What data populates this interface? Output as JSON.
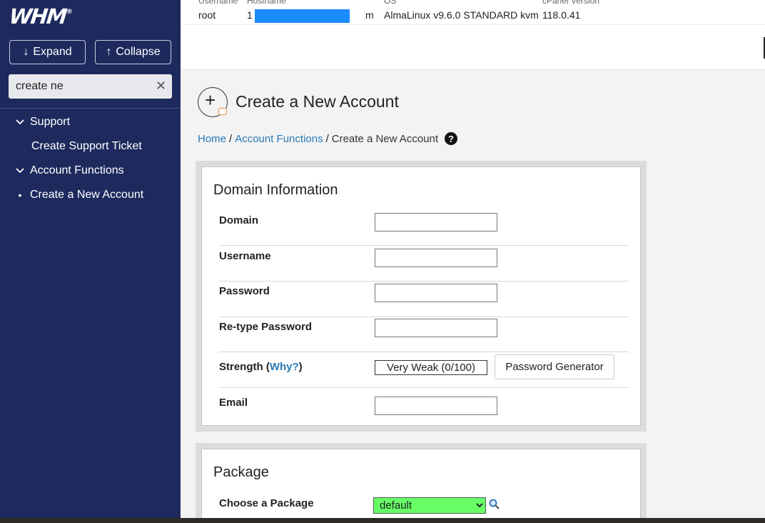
{
  "sidebar": {
    "logo": "WHM",
    "logo_mark": "®",
    "expand_label": "Expand",
    "collapse_label": "Collapse",
    "search_value": "create ne",
    "items": [
      {
        "label": "Support"
      },
      {
        "label": "Create Support Ticket"
      },
      {
        "label": "Account Functions"
      },
      {
        "label": "Create a New Account"
      }
    ]
  },
  "header": {
    "username_label": "Username",
    "username": "root",
    "hostname_label": "Hostname",
    "hostname_prefix": "1",
    "hostname_suffix": "m",
    "os_label": "OS",
    "os": "AlmaLinux v9.6.0 STANDARD kvm",
    "cpanel_label": "cPanel Version",
    "cpanel_version": "118.0.41"
  },
  "page": {
    "title": "Create a New Account",
    "breadcrumb": {
      "home": "Home",
      "section": "Account Functions",
      "current": "Create a New Account",
      "sep": "/"
    }
  },
  "domain_info": {
    "title": "Domain Information",
    "domain_label": "Domain",
    "username_label": "Username",
    "password_label": "Password",
    "retype_label": "Re-type Password",
    "strength_label": "Strength",
    "strength_why": "Why?",
    "strength_value": "Very Weak (0/100)",
    "password_generator": "Password Generator",
    "email_label": "Email"
  },
  "package": {
    "title": "Package",
    "choose_label": "Choose a Package",
    "selected": "default",
    "options": [
      "default"
    ]
  },
  "colors": {
    "sidebar_bg": "#1e2a5e",
    "link": "#2a7ab8",
    "package_select_bg": "#66ff66",
    "hostname_redaction": "#1a8cff"
  }
}
